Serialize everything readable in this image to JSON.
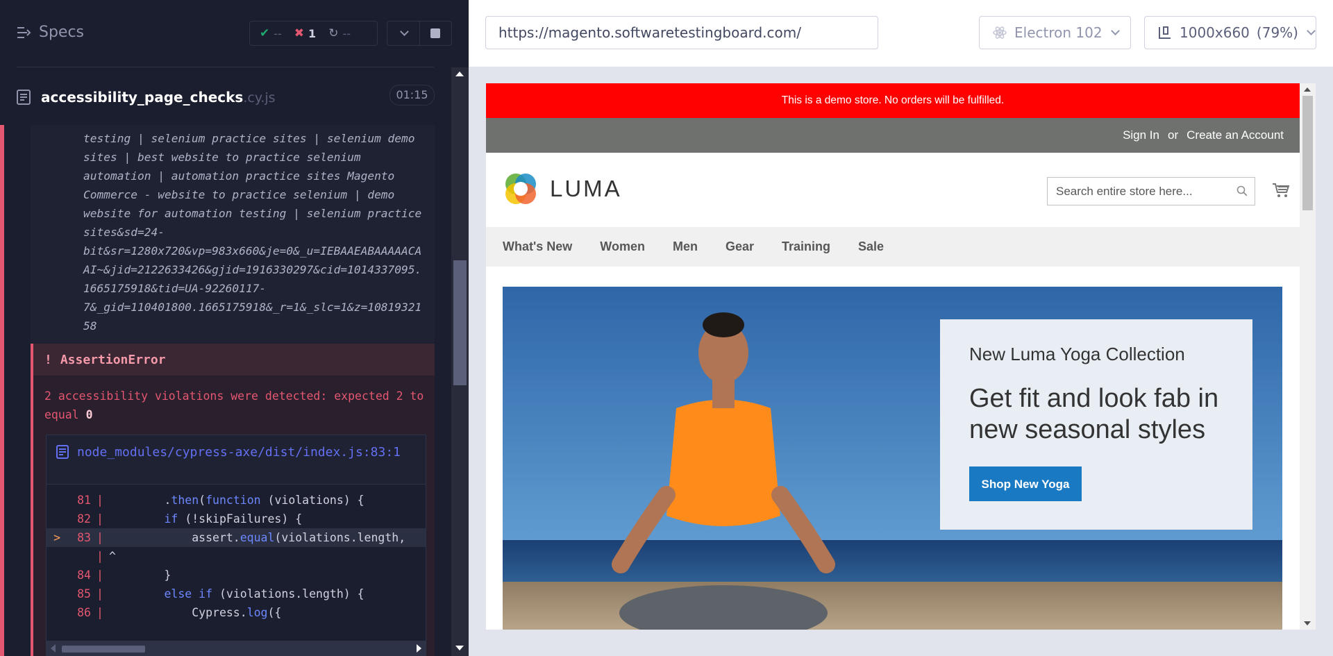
{
  "reporter": {
    "specs_label": "Specs",
    "stats": {
      "passed": "--",
      "failed": "1",
      "pending": "--"
    },
    "spec_name": "accessibility_page_checks",
    "spec_ext": ".cy.js",
    "duration": "01:15",
    "log_lines": [
      "testing | selenium practice sites | selenium demo",
      "sites | best website to practice selenium",
      "automation | automation practice sites Magento",
      "Commerce - website to practice selenium | demo",
      "website for automation testing | selenium practice",
      "sites&sd=24-",
      "bit&sr=1280x720&vp=983x660&je=0&_u=IEBAAEABAAAAACA",
      "AI~&jid=2122633426&gjid=1916330297&cid=1014337095.",
      "1665175918&tid=UA-92260117-",
      "7&_gid=110401800.1665175918&_r=1&_slc=1&z=10819321",
      "58"
    ],
    "error": {
      "bang": "!",
      "type": "AssertionError",
      "message": "2 accessibility violations were detected: expected 2 to equal",
      "message_value": "0",
      "file_path": "node_modules/cypress-axe/dist/index.js:83:1",
      "code_lines": [
        {
          "num": "81",
          "code": "        .then(function (violations) {"
        },
        {
          "num": "82",
          "code": "        if (!skipFailures) {"
        },
        {
          "num": "83",
          "code": "            assert.equal(violations.length,",
          "highlight": true
        },
        {
          "num": "",
          "code": "^"
        },
        {
          "num": "84",
          "code": "        }"
        },
        {
          "num": "85",
          "code": "        else if (violations.length) {"
        },
        {
          "num": "86",
          "code": "            Cypress.log({"
        }
      ]
    }
  },
  "aut": {
    "url": "https://magento.softwaretestingboard.com/",
    "browser": "Electron 102",
    "viewport": "1000x660",
    "scale": "(79%)"
  },
  "site": {
    "demo_notice": "This is a demo store. No orders will be fulfilled.",
    "sign_in": "Sign In",
    "or": "or",
    "create_account": "Create an Account",
    "logo": "LUMA",
    "search_placeholder": "Search entire store here...",
    "nav": [
      "What's New",
      "Women",
      "Men",
      "Gear",
      "Training",
      "Sale"
    ],
    "hero": {
      "subtitle": "New Luma Yoga Collection",
      "title": "Get fit and look fab in new seasonal styles",
      "button": "Shop New Yoga"
    }
  },
  "colors": {
    "reporter_bg": "#1b1e2e",
    "fail": "#e45770",
    "pass": "#1fa971",
    "demo_notice_bg": "#ff0101",
    "luma_button": "#1979c3"
  }
}
